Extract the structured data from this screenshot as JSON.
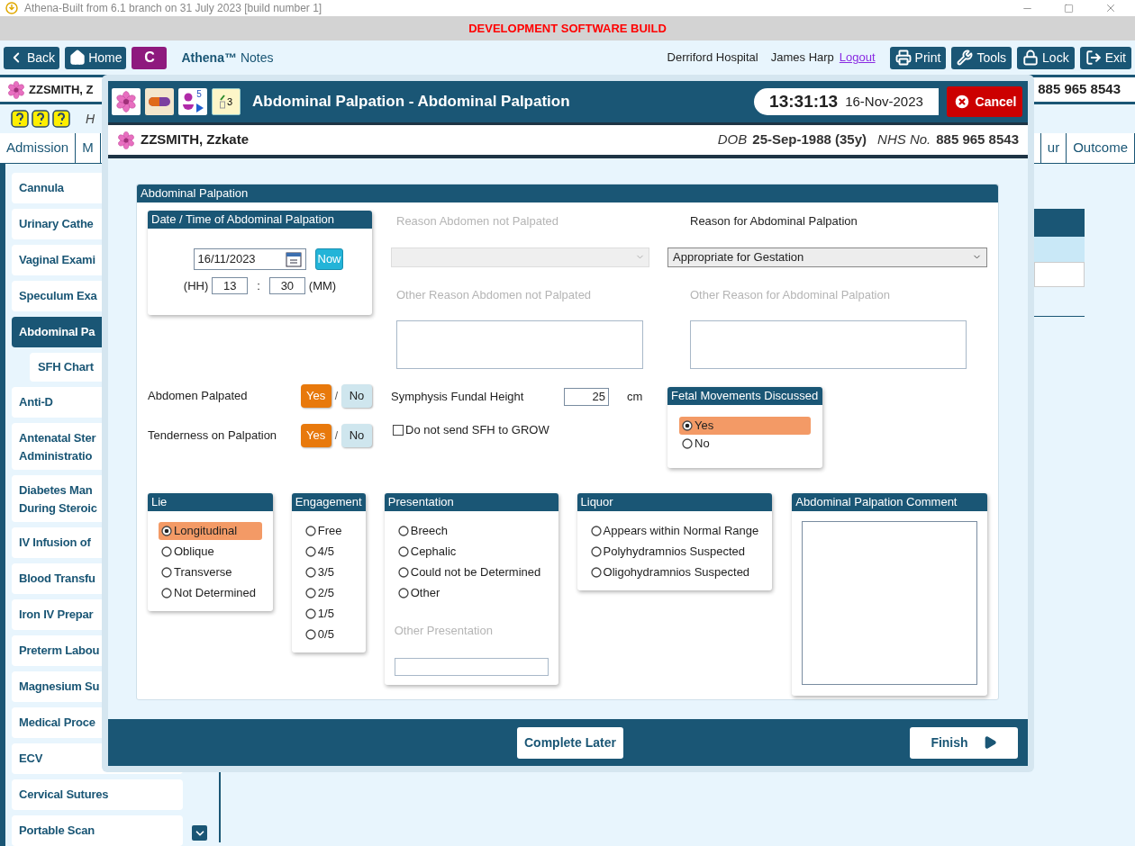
{
  "window": {
    "title": "Athena-Built from 6.1 branch on 31 July 2023 [build number 1]"
  },
  "banner": "DEVELOPMENT SOFTWARE BUILD",
  "toolbar": {
    "left_buttons": [
      {
        "kind": "back",
        "label": "Back"
      },
      {
        "kind": "home",
        "label": "Home"
      },
      {
        "kind": "letter",
        "label": "C"
      }
    ],
    "app_name": "Athena™",
    "app_section": "Notes",
    "hospital": "Derriford Hospital",
    "user": "James Harp",
    "logout": "Logout",
    "right_buttons": [
      {
        "kind": "print",
        "label": "Print"
      },
      {
        "kind": "tools",
        "label": "Tools"
      },
      {
        "kind": "lock",
        "label": "Lock"
      },
      {
        "kind": "exit",
        "label": "Exit"
      }
    ]
  },
  "patient_bar": {
    "name": "ZZSMITH, Z",
    "nhs": "885 965 8543"
  },
  "info_row": {
    "text": "H"
  },
  "tabs": [
    {
      "label": "Admission",
      "selected": false
    },
    {
      "label": "M",
      "selected": false
    },
    {
      "label": "ur",
      "selected": false
    },
    {
      "label": "Outcome",
      "selected": false
    }
  ],
  "sidebar": {
    "items": [
      {
        "label": "Cannula",
        "selected": false
      },
      {
        "label": "Urinary Cathe",
        "selected": false
      },
      {
        "label": "Vaginal Exami",
        "selected": false
      },
      {
        "label": "Speculum Exa",
        "selected": false
      },
      {
        "label": "Abdominal Pa",
        "selected": true,
        "children": [
          {
            "label": "SFH Chart",
            "selected": false
          }
        ]
      },
      {
        "label": "Anti-D",
        "selected": false
      },
      {
        "label": "Antenatal Ster\nAdministratio",
        "selected": false
      },
      {
        "label": "Diabetes Man\nDuring Steroic",
        "selected": false
      },
      {
        "label": "IV Infusion of",
        "selected": false
      },
      {
        "label": "Blood Transfu",
        "selected": false
      },
      {
        "label": "Iron IV Prepar",
        "selected": false
      },
      {
        "label": "Preterm Labou",
        "selected": false
      },
      {
        "label": "Magnesium Su",
        "selected": false
      },
      {
        "label": "Medical Proce",
        "selected": false
      },
      {
        "label": "ECV",
        "selected": false
      },
      {
        "label": "Cervical Sutures",
        "selected": false
      },
      {
        "label": "Portable Scan",
        "selected": false
      }
    ]
  },
  "modal": {
    "header_icons": [
      {
        "kind": "flower"
      },
      {
        "kind": "pills"
      },
      {
        "kind": "baby",
        "count": "5"
      },
      {
        "kind": "notes",
        "count": "3"
      }
    ],
    "title": "Abdominal Palpation - Abdominal Palpation",
    "time": "13:31:13",
    "date": "16-Nov-2023",
    "cancel": "Cancel",
    "patient": {
      "name": "ZZSMITH, Zzkate",
      "dob_label": "DOB",
      "dob": "25-Sep-1988 (35y)",
      "nhs_label": "NHS No.",
      "nhs": "885 965 8543"
    },
    "form": {
      "title": "Abdominal Palpation",
      "datetime": {
        "title": "Date / Time of Abdominal Palpation",
        "date": "16/11/2023",
        "now": "Now",
        "hh_label": "(HH)",
        "hh": "13",
        "sep": ":",
        "mm": "30",
        "mm_label": "(MM)"
      },
      "reason_not_palpated": {
        "label": "Reason Abdomen not Palpated",
        "disabled": true
      },
      "other_reason_not_palpated": {
        "label": "Other Reason Abdomen not Palpated",
        "disabled": true
      },
      "reason_palpation": {
        "label": "Reason for Abdominal Palpation",
        "value": "Appropriate for Gestation",
        "disabled": false
      },
      "other_reason_palpation": {
        "label": "Other Reason for Abdominal Palpation",
        "disabled": true
      },
      "toggles": [
        {
          "label": "Abdomen Palpated",
          "separator": "/",
          "options": [
            {
              "label": "Yes",
              "selected": true
            },
            {
              "label": "No",
              "selected": false
            }
          ]
        },
        {
          "label": "Tenderness on Palpation",
          "separator": "/",
          "options": [
            {
              "label": "Yes",
              "selected": true
            },
            {
              "label": "No",
              "selected": false
            }
          ]
        }
      ],
      "sfh": {
        "label": "Symphysis Fundal Height",
        "value": "25",
        "unit": "cm"
      },
      "grow": {
        "label": "Do not send SFH to GROW",
        "checked": false
      },
      "fetal_movements": {
        "title": "Fetal Movements Discussed",
        "options": [
          {
            "label": "Yes",
            "selected": true
          },
          {
            "label": "No",
            "selected": false
          }
        ]
      },
      "groups": [
        {
          "title": "Lie",
          "options": [
            {
              "label": "Longitudinal",
              "selected": true
            },
            {
              "label": "Oblique",
              "selected": false
            },
            {
              "label": "Transverse",
              "selected": false
            },
            {
              "label": "Not Determined",
              "selected": false
            }
          ]
        },
        {
          "title": "Engagement",
          "options": [
            {
              "label": "Free",
              "selected": false
            },
            {
              "label": "4/5",
              "selected": false
            },
            {
              "label": "3/5",
              "selected": false
            },
            {
              "label": "2/5",
              "selected": false
            },
            {
              "label": "1/5",
              "selected": false
            },
            {
              "label": "0/5",
              "selected": false
            }
          ]
        },
        {
          "title": "Presentation",
          "options": [
            {
              "label": "Breech",
              "selected": false
            },
            {
              "label": "Cephalic",
              "selected": false
            },
            {
              "label": "Could not be Determined",
              "selected": false
            },
            {
              "label": "Other",
              "selected": false
            }
          ],
          "other_label": "Other Presentation"
        },
        {
          "title": "Liquor",
          "options": [
            {
              "label": "Appears within Normal Range",
              "selected": false
            },
            {
              "label": "Polyhydramnios Suspected",
              "selected": false
            },
            {
              "label": "Oligohydramnios Suspected",
              "selected": false
            }
          ]
        }
      ],
      "comment": {
        "title": "Abdominal Palpation Comment"
      }
    },
    "footer": {
      "complete_later": "Complete Later",
      "finish": "Finish"
    }
  }
}
